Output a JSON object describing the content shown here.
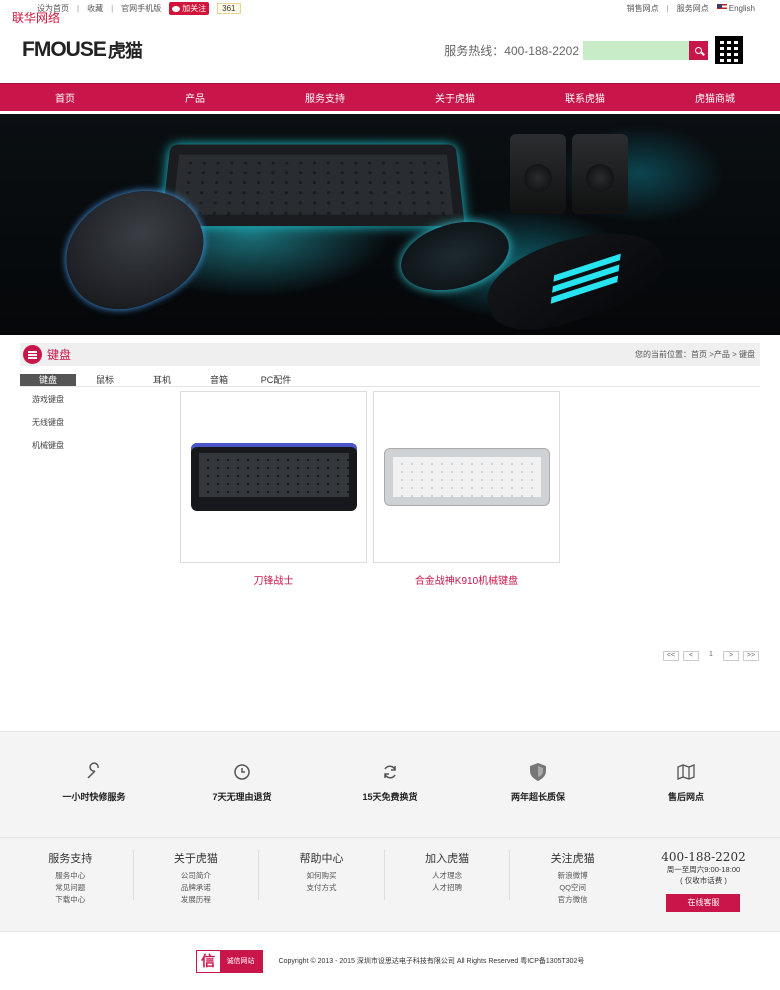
{
  "watermark": "联华网络",
  "topbar": {
    "home": "设为首页",
    "favorite": "收藏",
    "mobile": "官网手机版",
    "weibo_follow": "加关注",
    "follow_count": "361",
    "sales_outlets": "销售网点",
    "service_outlets": "服务网点",
    "english": "English"
  },
  "header": {
    "brand": "FMOUSE",
    "brand_cn": "虎猫",
    "hotline": "服务热线：400-188-2202",
    "search_placeholder": ""
  },
  "nav": [
    "首页",
    "产品",
    "服务支持",
    "关于虎猫",
    "联系虎猫",
    "虎猫商城"
  ],
  "section": {
    "title": "键盘",
    "breadcrumb": "您的当前位置：首页 >产品 > 键盘"
  },
  "category_tabs": [
    "键盘",
    "鼠标",
    "耳机",
    "音箱",
    "PC配件"
  ],
  "sidebar": [
    "游戏键盘",
    "无线键盘",
    "机械键盘"
  ],
  "products": [
    {
      "name": "刀锋战士",
      "image": "black-keyboard"
    },
    {
      "name": "合金战神K910机械键盘",
      "image": "silver-keyboard"
    }
  ],
  "pager": {
    "first": "<<",
    "prev": "<",
    "page": "1",
    "next": ">",
    "last": ">>"
  },
  "features": [
    {
      "icon": "wrench-icon",
      "label": "一小时快修服务"
    },
    {
      "icon": "clock-icon",
      "label": "7天无理由退货"
    },
    {
      "icon": "refresh-icon",
      "label": "15天免费换货"
    },
    {
      "icon": "shield-icon",
      "label": "两年超长质保"
    },
    {
      "icon": "map-icon",
      "label": "售后网点"
    }
  ],
  "footer": {
    "columns": [
      {
        "title": "服务支持",
        "links": [
          "服务中心",
          "常见问题",
          "下载中心"
        ]
      },
      {
        "title": "关于虎猫",
        "links": [
          "公司简介",
          "品牌承诺",
          "发展历程"
        ]
      },
      {
        "title": "帮助中心",
        "links": [
          "如何购买",
          "支付方式"
        ]
      },
      {
        "title": "加入虎猫",
        "links": [
          "人才理念",
          "人才招聘"
        ]
      },
      {
        "title": "关注虎猫",
        "links": [
          "新浪微博",
          "QQ空间",
          "官方微信"
        ]
      }
    ],
    "contact": {
      "phone": "400-188-2202",
      "hours": "周一至周六9:00-18:00",
      "charge": "( 仅收市话费 )",
      "online_service": "在线客服"
    }
  },
  "copyright": {
    "trust_icon": "信",
    "trust_text": "诚信网站",
    "text": "Copyright © 2013 - 2015  深圳市设思达电子科技有限公司  All Rights Reserved  粤ICP备1305T302号"
  },
  "colors": {
    "accent": "#c8164a",
    "search_field": "#c8ebc8"
  }
}
